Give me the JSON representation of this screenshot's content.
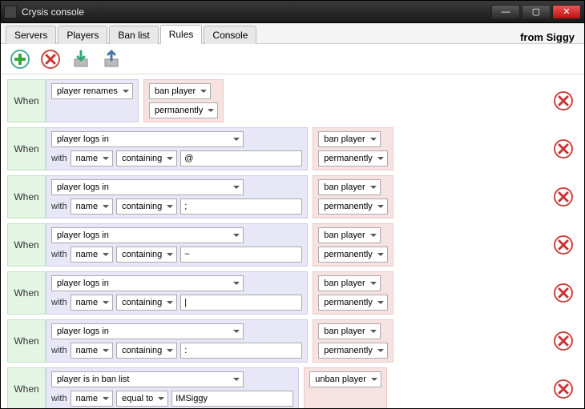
{
  "window": {
    "title": "Crysis console"
  },
  "tabs": [
    "Servers",
    "Players",
    "Ban list",
    "Rules",
    "Console"
  ],
  "active_tab": 3,
  "from_label": "from Siggy",
  "when_label": "When",
  "with_label": "with",
  "rules": [
    {
      "event": "player renames",
      "filter": null,
      "action": "ban player",
      "action2": "permanently",
      "cond_narrow": true
    },
    {
      "event": "player logs in",
      "filter": {
        "field": "name",
        "op": "containing",
        "value": "@"
      },
      "action": "ban player",
      "action2": "permanently"
    },
    {
      "event": "player logs in",
      "filter": {
        "field": "name",
        "op": "containing",
        "value": ";"
      },
      "action": "ban player",
      "action2": "permanently"
    },
    {
      "event": "player logs in",
      "filter": {
        "field": "name",
        "op": "containing",
        "value": "~"
      },
      "action": "ban player",
      "action2": "permanently"
    },
    {
      "event": "player logs in",
      "filter": {
        "field": "name",
        "op": "containing",
        "value": "|"
      },
      "action": "ban player",
      "action2": "permanently"
    },
    {
      "event": "player logs in",
      "filter": {
        "field": "name",
        "op": "containing",
        "value": ":"
      },
      "action": "ban player",
      "action2": "permanently"
    },
    {
      "event": "player is in ban list",
      "filter": {
        "field": "name",
        "op": "equal to",
        "value": "IMSiggy"
      },
      "action": "unban player",
      "action2": null
    }
  ]
}
